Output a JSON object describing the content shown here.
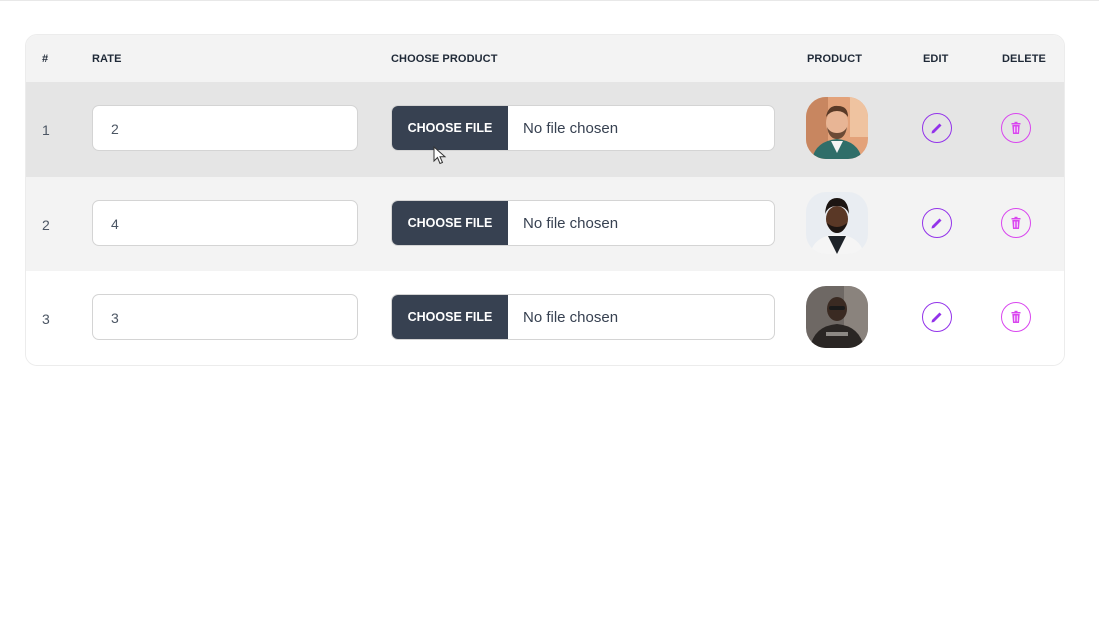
{
  "table": {
    "headers": {
      "index": "#",
      "rate": "RATE",
      "choose_product": "CHOOSE PRODUCT",
      "product": "PRODUCT",
      "edit": "EDIT",
      "delete": "DELETE"
    },
    "rows": [
      {
        "index": "1",
        "rate": "2",
        "file_button": "CHOOSE FILE",
        "file_status": "No file chosen"
      },
      {
        "index": "2",
        "rate": "4",
        "file_button": "CHOOSE FILE",
        "file_status": "No file chosen"
      },
      {
        "index": "3",
        "rate": "3",
        "file_button": "CHOOSE FILE",
        "file_status": "No file chosen"
      }
    ]
  },
  "icons": {
    "edit": "pencil-icon",
    "delete": "trash-icon",
    "cursor": "mouse-pointer"
  },
  "colors": {
    "file_button_bg": "#374151",
    "edit_accent": "#9333ea",
    "delete_accent": "#d946ef",
    "header_bg": "#f3f3f3",
    "selected_row_bg": "#e5e5e5"
  }
}
